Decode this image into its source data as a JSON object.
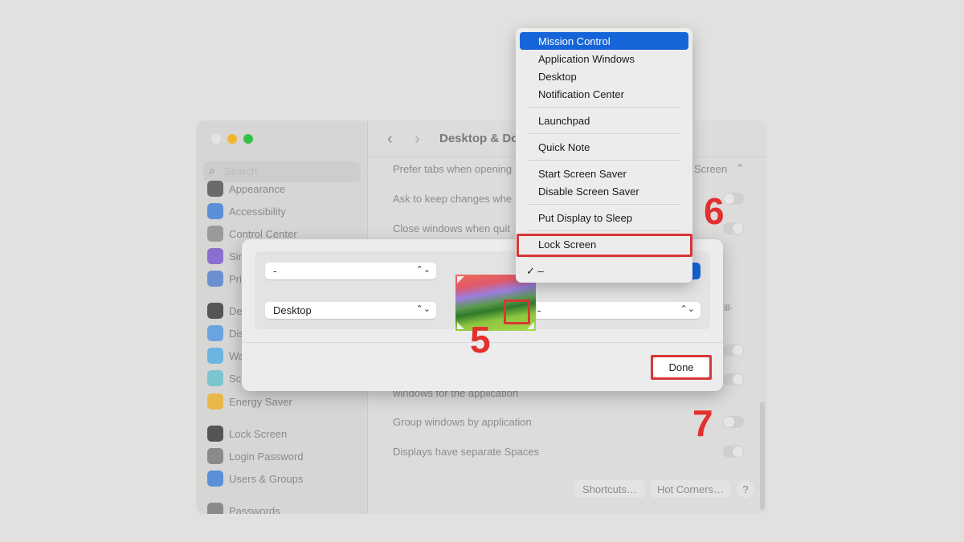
{
  "window": {
    "title": "Desktop & Do",
    "search_placeholder": "Search",
    "sidebar": [
      {
        "label": "Appearance",
        "color": "#6b6b6b"
      },
      {
        "label": "Accessibility",
        "color": "#5b8fd6"
      },
      {
        "label": "Control Center",
        "color": "#9a9a9a"
      },
      {
        "label": "Sir",
        "color": "#8a6fcf"
      },
      {
        "label": "Pri",
        "color": "#6b8fd0"
      },
      {
        "label": "De",
        "color": "#555555"
      },
      {
        "label": "Dis",
        "color": "#6aa3e0"
      },
      {
        "label": "Wa",
        "color": "#6ab6e0"
      },
      {
        "label": "Scr",
        "color": "#7ac6d0"
      },
      {
        "label": "Energy Saver",
        "color": "#e8b84a"
      },
      {
        "label": "Lock Screen",
        "color": "#555555"
      },
      {
        "label": "Login Password",
        "color": "#8a8a8a"
      },
      {
        "label": "Users & Groups",
        "color": "#5b8fd6"
      },
      {
        "label": "Passwords",
        "color": "#8a8a8a"
      }
    ],
    "rows": {
      "prefer_tabs": "Prefer tabs when opening",
      "prefer_tabs_value": "Screen",
      "ask_keep": "Ask to keep changes whe",
      "close_windows": "Close windows when quit",
      "ends_ill": "ill-",
      "windows_for_app": "windows for the application",
      "group_windows": "Group windows by application",
      "separate_spaces": "Displays have separate Spaces"
    },
    "buttons": {
      "shortcuts": "Shortcuts…",
      "hot_corners": "Hot Corners…",
      "help": "?"
    }
  },
  "dialog": {
    "top_left": "-",
    "bottom_left": "Desktop",
    "bottom_right": "-",
    "done": "Done"
  },
  "menu": {
    "groups": [
      [
        "Mission Control",
        "Application Windows",
        "Desktop",
        "Notification Center"
      ],
      [
        "Launchpad"
      ],
      [
        "Quick Note"
      ],
      [
        "Start Screen Saver",
        "Disable Screen Saver"
      ],
      [
        "Put Display to Sleep"
      ],
      [
        "Lock Screen"
      ]
    ],
    "highlighted": "Mission Control",
    "checked_item": "–",
    "check": "✓"
  },
  "annotations": {
    "step5": "5",
    "step6": "6",
    "step7": "7",
    "color": "#e42f2f"
  },
  "colors": {
    "accent": "#1665d8"
  }
}
